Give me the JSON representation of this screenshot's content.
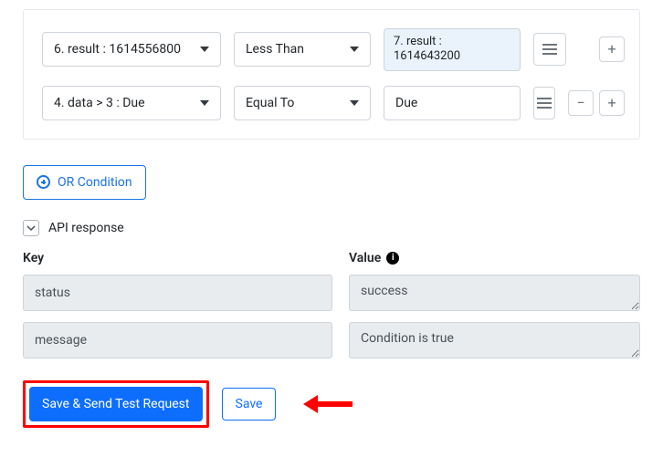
{
  "conditions": [
    {
      "left": "6. result : 1614556800",
      "op": "Less Than",
      "rightToken": "7. result : 1614643200",
      "showMinus": false
    },
    {
      "left": "4. data > 3 : Due",
      "op": "Equal To",
      "rightText": "Due",
      "showMinus": true
    }
  ],
  "orButton": "OR Condition",
  "apiResponseLabel": "API response",
  "kvHeader": {
    "key": "Key",
    "value": "Value"
  },
  "kv": [
    {
      "key": "status",
      "value": "success"
    },
    {
      "key": "message",
      "value": "Condition is true"
    }
  ],
  "actions": {
    "primary": "Save & Send Test Request",
    "secondary": "Save"
  }
}
